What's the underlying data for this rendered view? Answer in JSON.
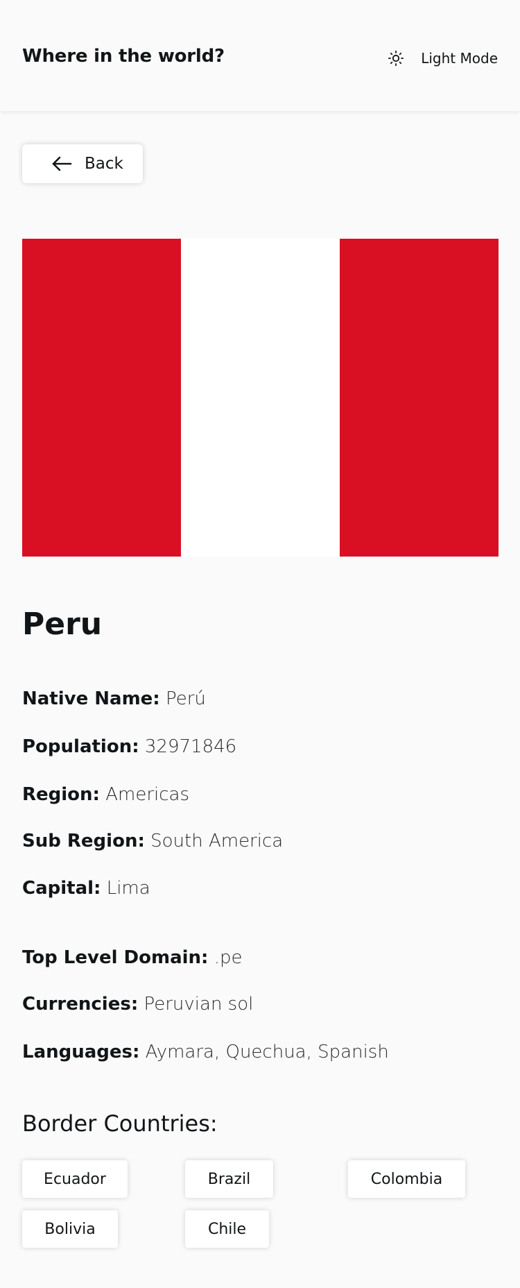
{
  "header": {
    "title": "Where in the world?",
    "mode_label": "Light Mode",
    "mode_icon": "sun-icon"
  },
  "back": {
    "label": "Back",
    "icon": "arrow-left-icon"
  },
  "flag": {
    "colors": [
      "#d91023",
      "#ffffff",
      "#d91023"
    ]
  },
  "country": {
    "name": "Peru",
    "details": [
      {
        "label": "Native Name:",
        "value": "Perú"
      },
      {
        "label": "Population:",
        "value": "32971846"
      },
      {
        "label": "Region:",
        "value": "Americas"
      },
      {
        "label": "Sub Region:",
        "value": "South America"
      },
      {
        "label": "Capital:",
        "value": "Lima"
      },
      {
        "label": "Top Level Domain:",
        "value": ".pe"
      },
      {
        "label": "Currencies:",
        "value": "Peruvian sol"
      },
      {
        "label": "Languages:",
        "value": "Aymara, Quechua, Spanish"
      }
    ]
  },
  "borders": {
    "title": "Border Countries:",
    "countries": [
      "Ecuador",
      "Brazil",
      "Colombia",
      "Bolivia",
      "Chile"
    ]
  }
}
